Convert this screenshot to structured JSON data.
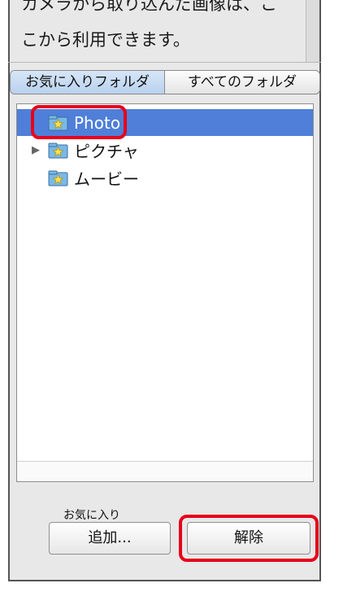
{
  "description": {
    "line1": "カメラから取り込んだ画像は、こ",
    "line2": "こから利用できます。"
  },
  "tabs": [
    {
      "label": "お気に入りフォルダ",
      "active": true
    },
    {
      "label": "すべてのフォルダ",
      "active": false
    }
  ],
  "tree": {
    "items": [
      {
        "label": "Photo",
        "selected": true,
        "expandable": false,
        "icon": "favorite-folder-icon"
      },
      {
        "label": "ピクチャ",
        "selected": false,
        "expandable": true,
        "icon": "favorite-folder-icon"
      },
      {
        "label": "ムービー",
        "selected": false,
        "expandable": false,
        "icon": "favorite-folder-icon"
      }
    ]
  },
  "favorites": {
    "label": "お気に入り",
    "add_button": "追加...",
    "remove_button": "解除"
  },
  "colors": {
    "selection": "#4f7fd9",
    "highlight_callout": "#e8001a"
  }
}
